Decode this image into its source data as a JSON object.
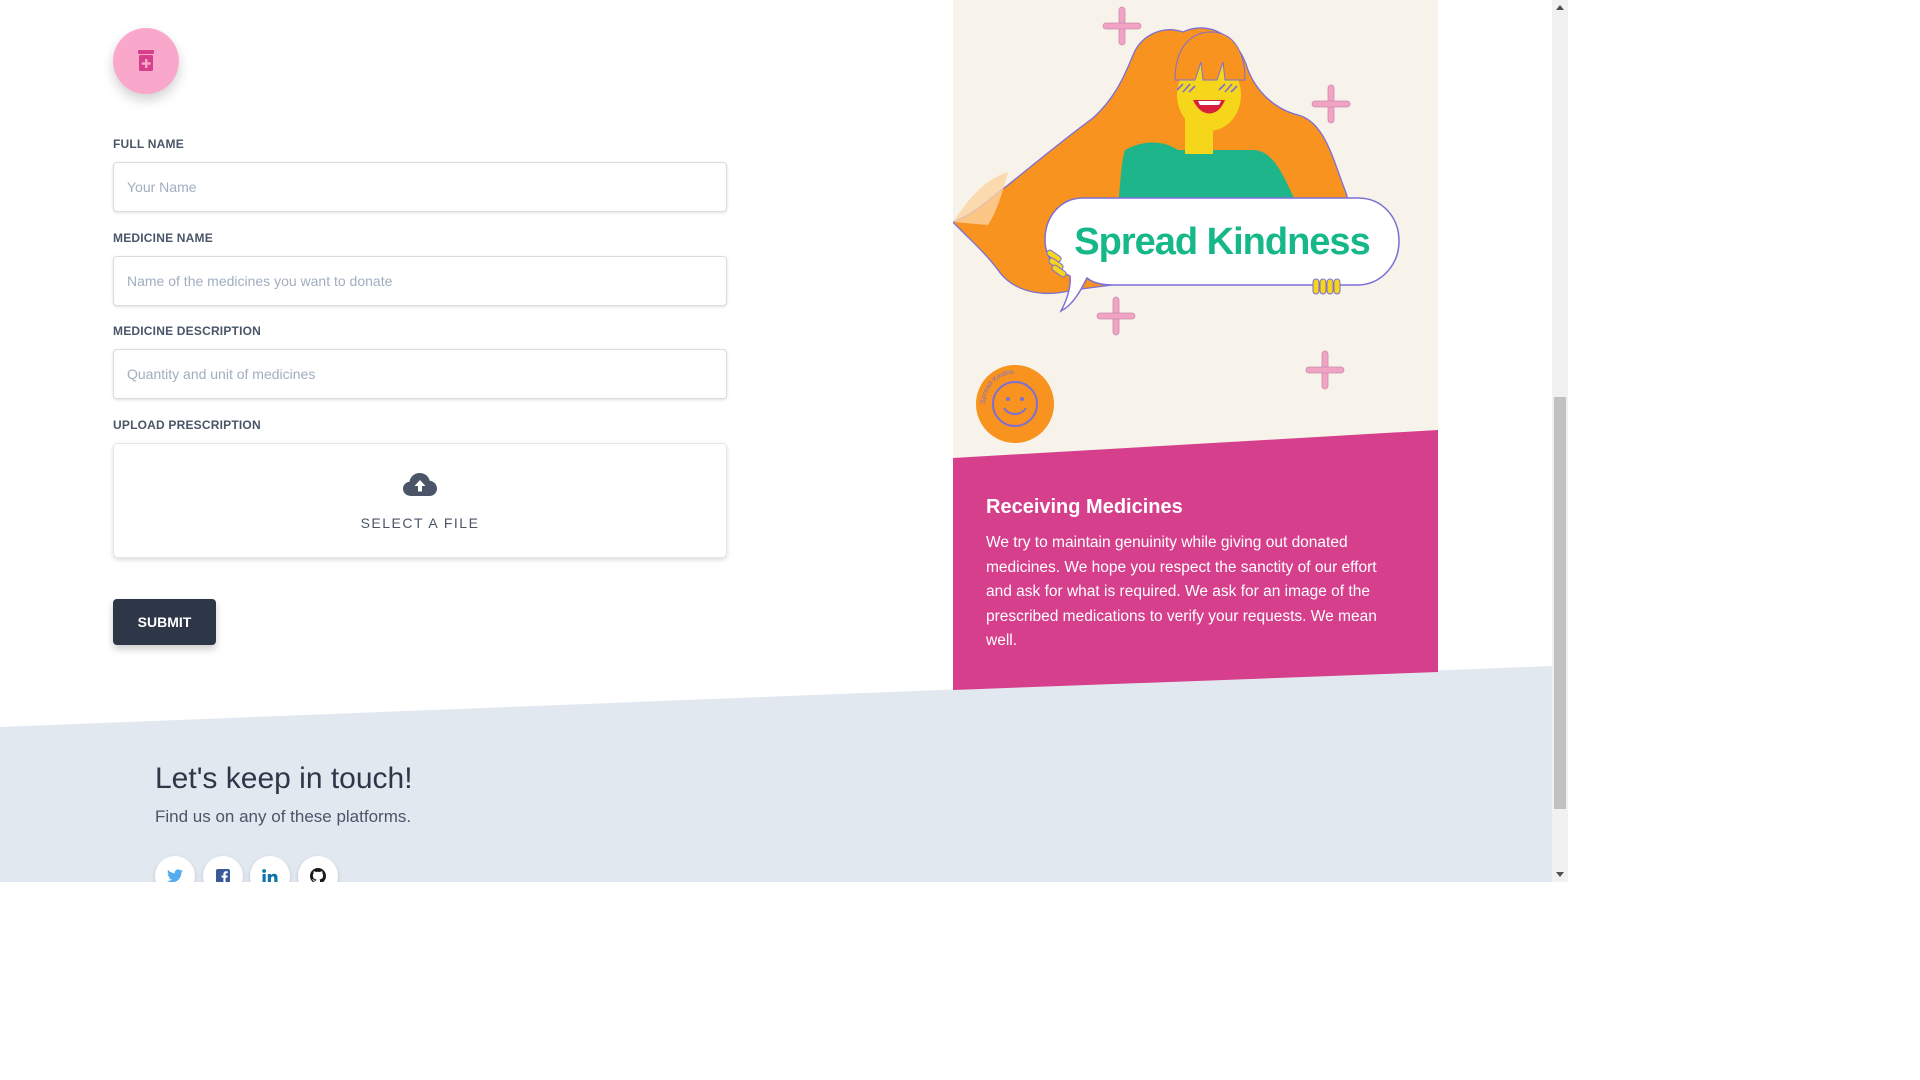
{
  "form": {
    "full_name": {
      "label": "FULL NAME",
      "placeholder": "Your Name",
      "value": ""
    },
    "medicine_name": {
      "label": "MEDICINE NAME",
      "placeholder": "Name of the medicines you want to donate",
      "value": ""
    },
    "medicine_description": {
      "label": "MEDICINE DESCRIPTION",
      "placeholder": "Quantity and unit of medicines",
      "value": ""
    },
    "upload": {
      "label": "UPLOAD PRESCRIPTION",
      "button_text": "SELECT A FILE"
    },
    "submit_label": "SUBMIT"
  },
  "card": {
    "illustration_text": "Spread Kindness",
    "sticker_text": "Spread Kindness",
    "title": "Receiving Medicines",
    "body": "We try to maintain genuinity while giving out donated medicines. We hope you respect the sanctity of our effort and ask for what is required. We ask for an image of the prescribed medications to verify your requests. We mean well."
  },
  "footer": {
    "title": "Let's keep in touch!",
    "subtitle": "Find us on any of these platforms.",
    "social": [
      {
        "name": "twitter-icon"
      },
      {
        "name": "facebook-icon"
      },
      {
        "name": "linkedin-icon"
      },
      {
        "name": "github-icon"
      }
    ]
  },
  "colors": {
    "accent_pink": "#d63f8c",
    "icon_circle": "#f9a8cc",
    "dark_button": "#2d3748",
    "footer_bg": "#e2e8f0",
    "illustration_bg": "#f7f3ea",
    "kindness_green": "#16b88a"
  }
}
